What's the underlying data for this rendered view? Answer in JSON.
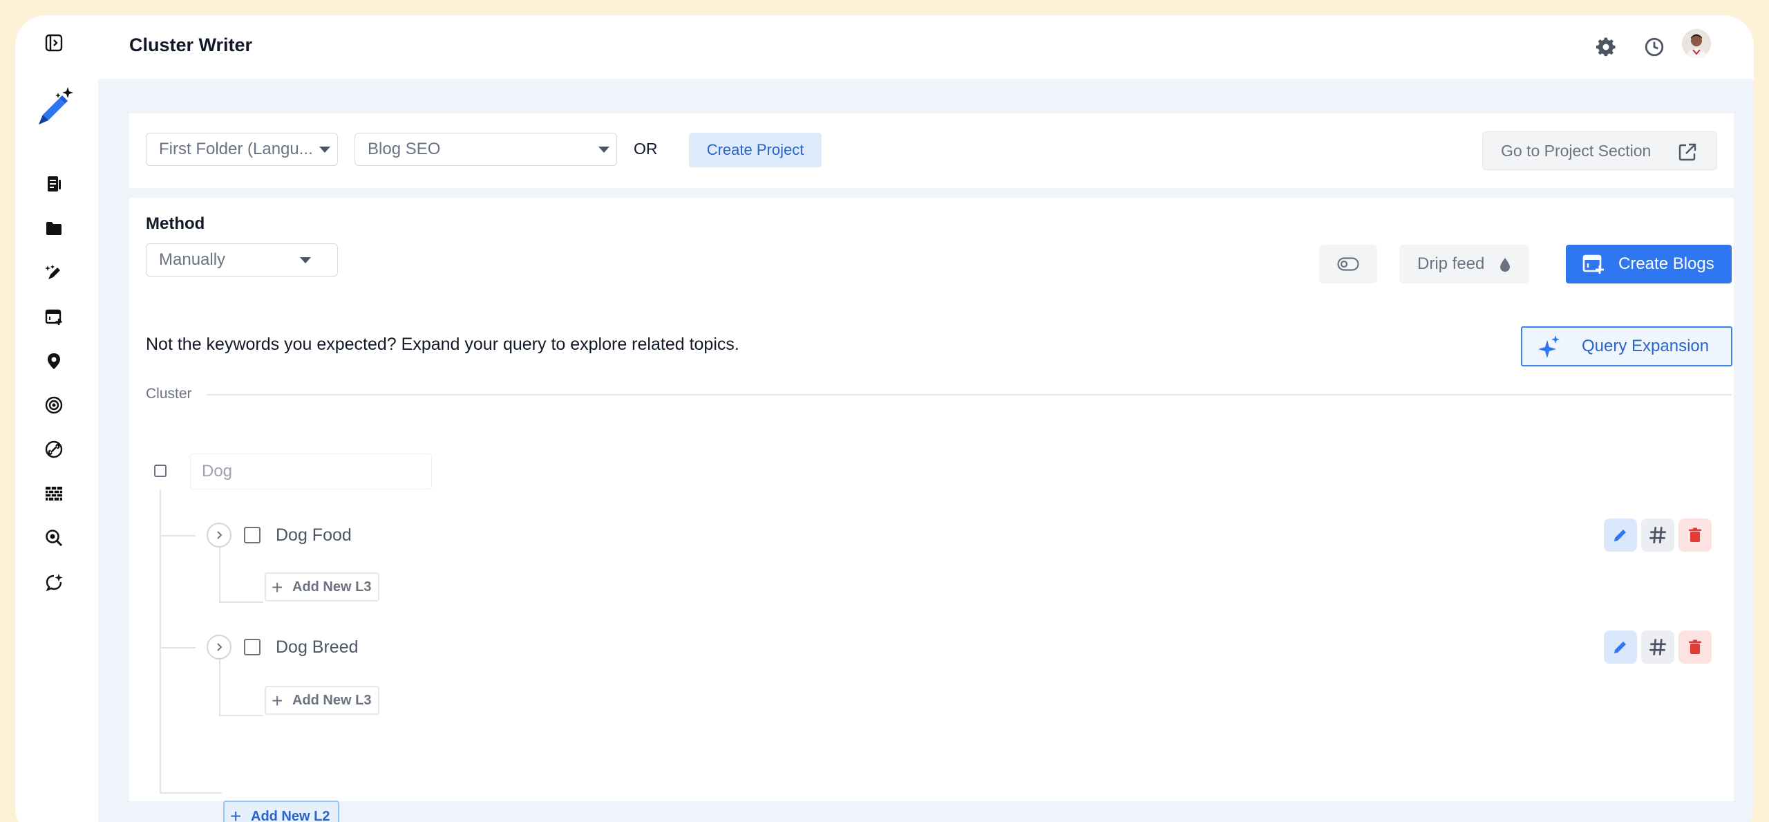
{
  "app": {
    "title": "Cluster Writer"
  },
  "sidebar": {
    "items": [
      {
        "icon": "document-icon"
      },
      {
        "icon": "folder-icon"
      },
      {
        "icon": "magic-pen-icon"
      },
      {
        "icon": "calendar-add-icon"
      },
      {
        "icon": "location-pin-icon"
      },
      {
        "icon": "target-icon"
      },
      {
        "icon": "link-icon"
      },
      {
        "icon": "brick-wall-icon"
      },
      {
        "icon": "search-zoom-icon"
      },
      {
        "icon": "sparkle-chat-icon"
      }
    ]
  },
  "toolbar": {
    "folder_select": "First Folder (Langu...",
    "project_select": "Blog SEO",
    "or_text": "OR",
    "create_project_label": "Create Project",
    "go_to_project_label": "Go to Project Section"
  },
  "method": {
    "label": "Method",
    "selected": "Manually"
  },
  "actions": {
    "drip_feed_label": "Drip feed",
    "create_blogs_label": "Create Blogs",
    "query_expansion_label": "Query Expansion"
  },
  "hint_text": "Not the keywords you expected? Expand your query to explore related topics.",
  "cluster": {
    "label": "Cluster",
    "root_placeholder": "Dog",
    "children": [
      {
        "label": "Dog Food",
        "add_l3": "Add New L3"
      },
      {
        "label": "Dog Breed",
        "add_l3": "Add New L3"
      }
    ],
    "add_l2_label": "Add New L2"
  },
  "colors": {
    "accent": "#2f77f0",
    "frame_bg": "#fdf1d6",
    "main_bg": "#eff3fa",
    "delete": "#e53935"
  }
}
